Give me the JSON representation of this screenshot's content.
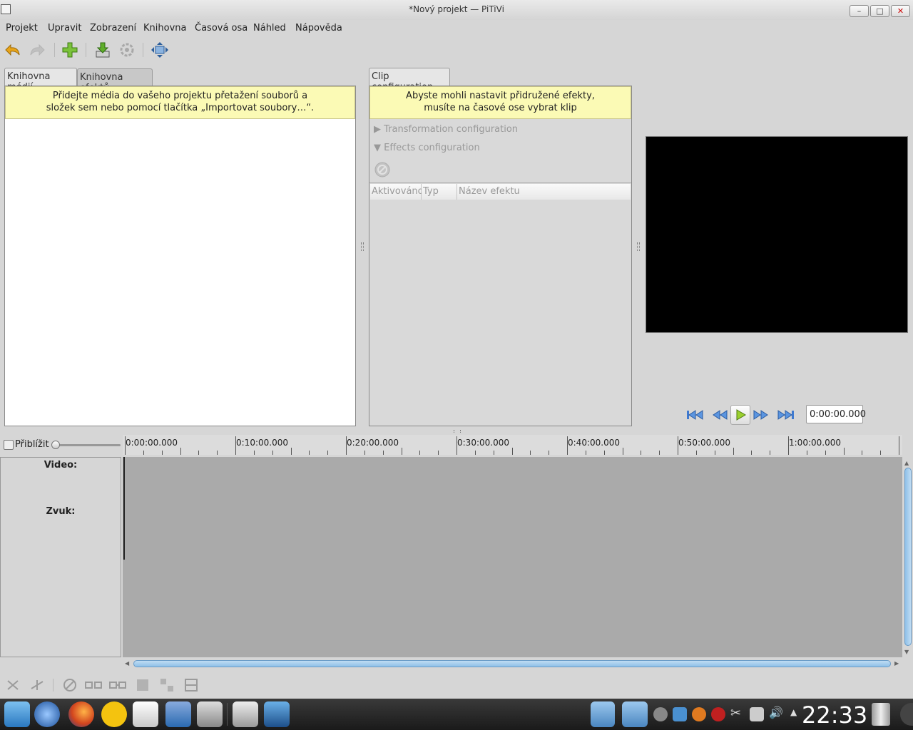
{
  "window": {
    "title": "*Nový projekt — PiTiVi"
  },
  "menu": [
    "Projekt",
    "Upravit",
    "Zobrazení",
    "Knihovna",
    "Časová osa",
    "Náhled",
    "Nápověda"
  ],
  "toolbar": {
    "icons": [
      "undo-icon",
      "redo-icon",
      "add-media-icon",
      "import-icon",
      "render-icon",
      "fullscreen-icon"
    ]
  },
  "library": {
    "tabs": [
      "Knihovna médií",
      "Knihovna efektů"
    ],
    "info_line1": "Přidejte média do vašeho projektu přetažení souborů a",
    "info_line2": "složek sem nebo pomocí tlačítka „Importovat soubory…“."
  },
  "clip": {
    "tab": "Clip configuration",
    "info_line1": "Abyste mohli nastavit přidružené efekty,",
    "info_line2": "musíte na časové ose vybrat klip",
    "transformation": "Transformation configuration",
    "effects": "Effects configuration",
    "columns": [
      "Aktivováno",
      "Typ",
      "Název efektu"
    ]
  },
  "viewer": {
    "timecode": "0:00:00.000"
  },
  "timeline": {
    "zoom_label": "Přiblížit",
    "zoom_level": 0,
    "ruler": [
      "0:00:00.000",
      "0:10:00.000",
      "0:20:00.000",
      "0:30:00.000",
      "0:40:00.000",
      "0:50:00.000",
      "1:00:00.000"
    ],
    "tracks": [
      "Video:",
      "Zvuk:"
    ]
  },
  "taskbar": {
    "clock": "22:33"
  }
}
